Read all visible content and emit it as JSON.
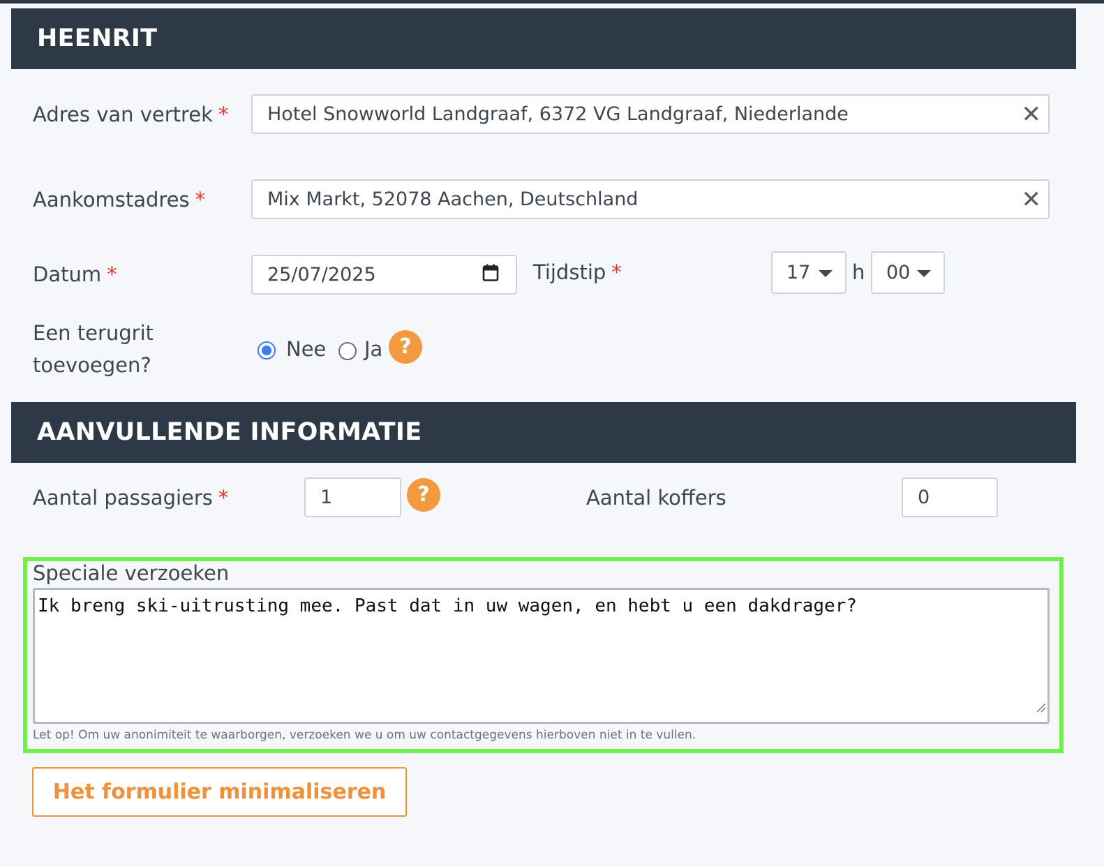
{
  "outbound": {
    "header": "HEENRIT",
    "departure": {
      "label": "Adres van vertrek",
      "required_mark": "*",
      "value": "Hotel Snowworld Landgraaf, 6372 VG Landgraaf, Niederlande",
      "clear_icon": "close-icon"
    },
    "arrival": {
      "label": "Aankomstadres",
      "required_mark": "*",
      "value": "Mix Markt, 52078 Aachen, Deutschland",
      "clear_icon": "close-icon"
    },
    "date": {
      "label": "Datum",
      "required_mark": "*",
      "value": "25/07/2025",
      "icon": "calendar-icon"
    },
    "time": {
      "label": "Tijdstip",
      "required_mark": "*",
      "hour": "17",
      "separator": "h",
      "minute": "00"
    },
    "return_trip": {
      "label_line1": "Een terugrit",
      "label_line2": "toevoegen?",
      "options": [
        {
          "label": "Nee",
          "checked": true
        },
        {
          "label": "Ja",
          "checked": false
        }
      ],
      "help_icon": "?"
    }
  },
  "additional": {
    "header": "AANVULLENDE INFORMATIE",
    "passengers": {
      "label": "Aantal passagiers",
      "required_mark": "*",
      "value": "1",
      "help_icon": "?"
    },
    "luggage": {
      "label": "Aantal koffers",
      "value": "0"
    },
    "special_requests": {
      "label": "Speciale verzoeken",
      "value": "Ik breng ski-uitrusting mee. Past dat in uw wagen, en hebt u een dakdrager?",
      "hint": "Let op! Om uw anonimiteit te waarborgen, verzoeken we u om uw contactgegevens hierboven niet in te vullen."
    }
  },
  "minimize_button": "Het formulier minimaliseren",
  "colors": {
    "header_bg": "#2e3947",
    "accent_orange": "#f0913a",
    "required_red": "#e0352b",
    "radio_blue": "#3b7ded",
    "highlight_green": "#6ff04b"
  }
}
